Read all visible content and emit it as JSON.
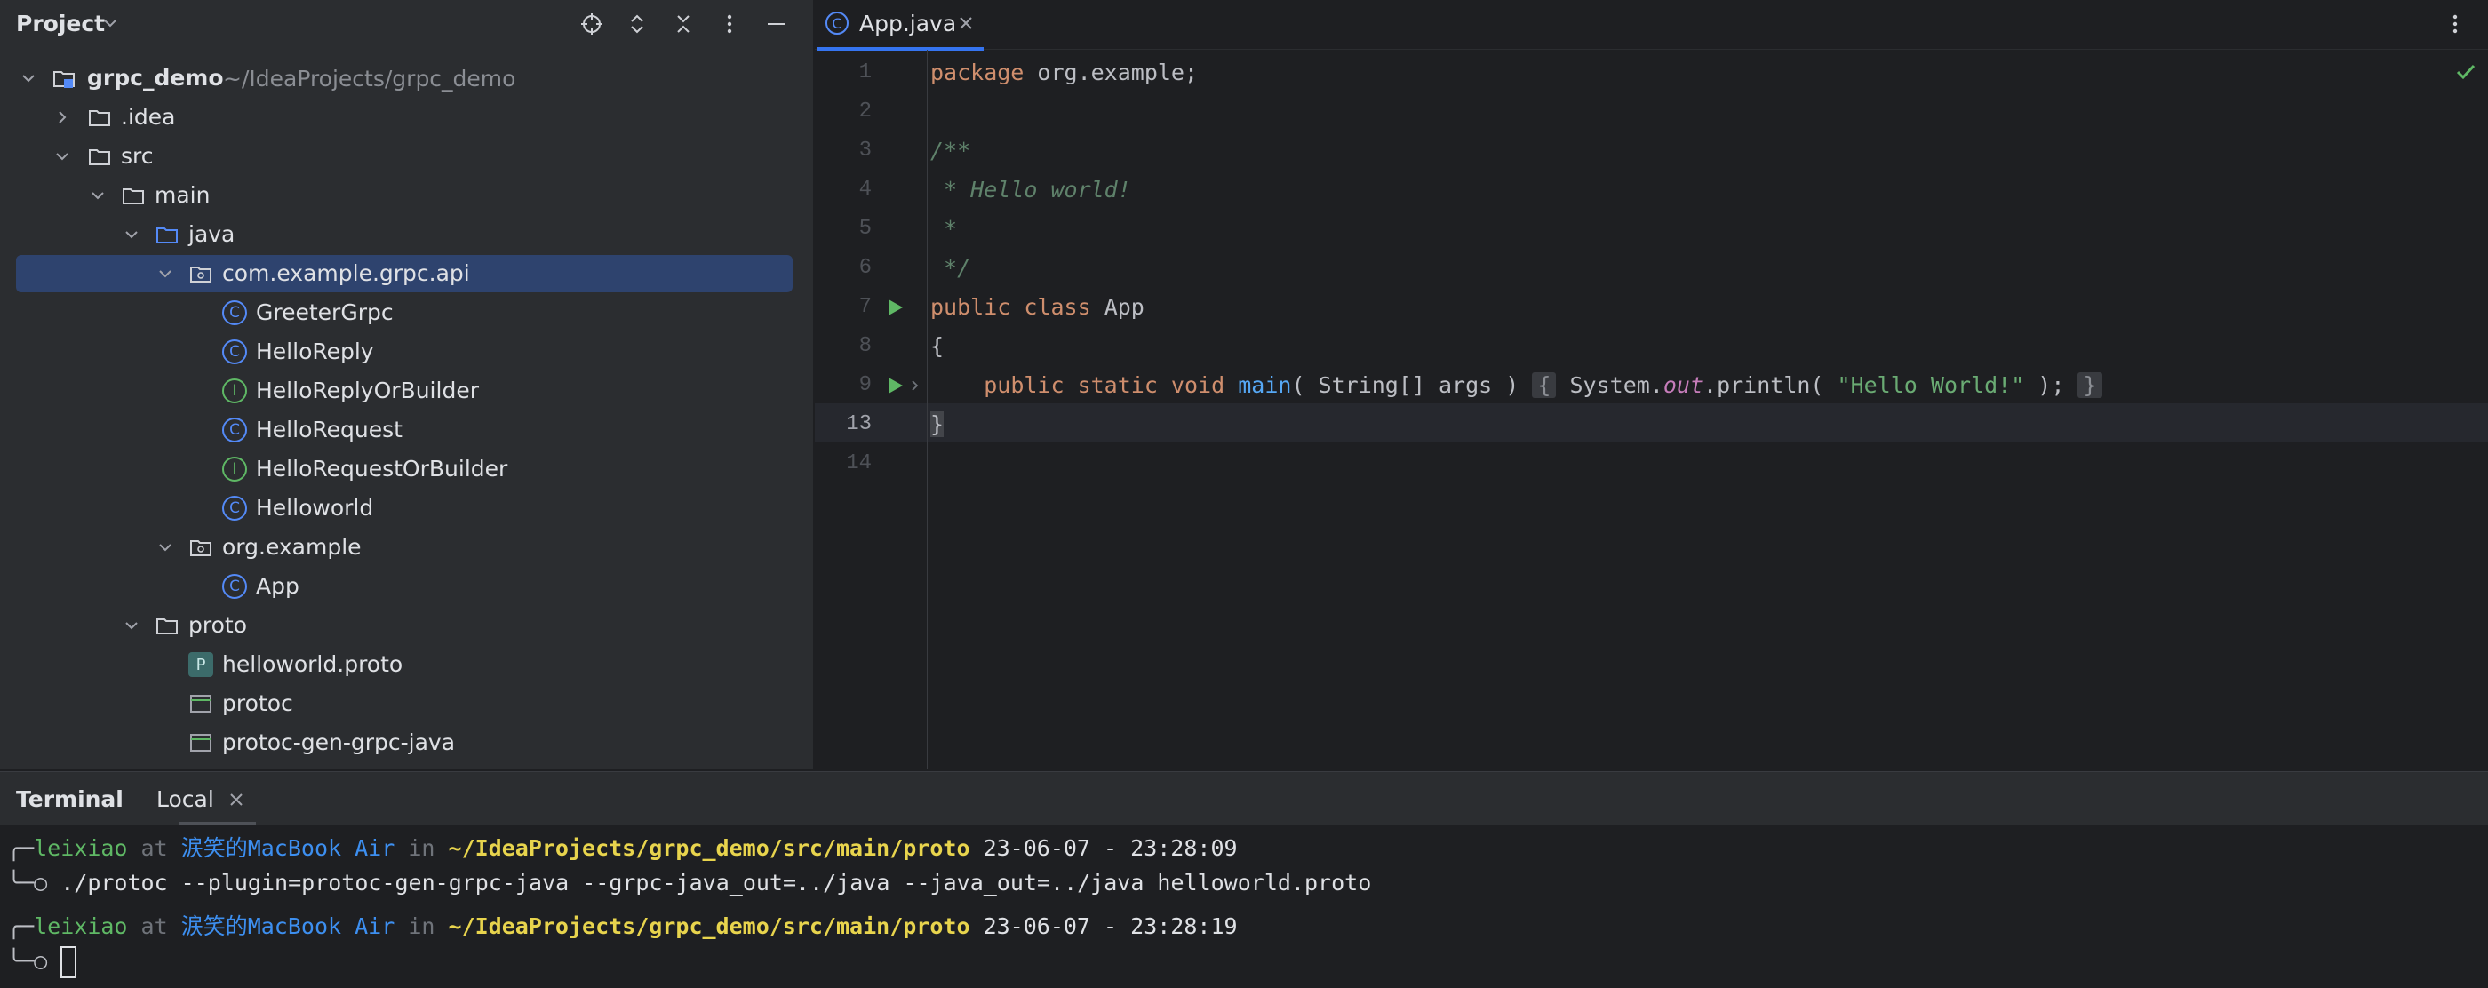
{
  "project_panel": {
    "title": "Project",
    "tree": [
      {
        "label": "grpc_demo",
        "path": "~/IdeaProjects/grpc_demo",
        "type": "module",
        "expanded": true
      },
      {
        "label": ".idea",
        "type": "folder",
        "expanded": false
      },
      {
        "label": "src",
        "type": "folder",
        "expanded": true
      },
      {
        "label": "main",
        "type": "folder",
        "expanded": true
      },
      {
        "label": "java",
        "type": "source-folder",
        "expanded": true
      },
      {
        "label": "com.example.grpc.api",
        "type": "package",
        "expanded": true,
        "selected": true
      },
      {
        "label": "GreeterGrpc",
        "type": "class"
      },
      {
        "label": "HelloReply",
        "type": "class"
      },
      {
        "label": "HelloReplyOrBuilder",
        "type": "interface"
      },
      {
        "label": "HelloRequest",
        "type": "class"
      },
      {
        "label": "HelloRequestOrBuilder",
        "type": "interface"
      },
      {
        "label": "Helloworld",
        "type": "class"
      },
      {
        "label": "org.example",
        "type": "package",
        "expanded": true
      },
      {
        "label": "App",
        "type": "class"
      },
      {
        "label": "proto",
        "type": "folder",
        "expanded": true
      },
      {
        "label": "helloworld.proto",
        "type": "proto-file"
      },
      {
        "label": "protoc",
        "type": "executable"
      },
      {
        "label": "protoc-gen-grpc-java",
        "type": "executable"
      }
    ],
    "badge_class": "C",
    "badge_interface": "I",
    "badge_proto": "P"
  },
  "editor": {
    "tab": {
      "label": "App.java",
      "badge": "C"
    },
    "lines": [
      {
        "num": "1"
      },
      {
        "num": "2"
      },
      {
        "num": "3"
      },
      {
        "num": "4"
      },
      {
        "num": "5"
      },
      {
        "num": "6"
      },
      {
        "num": "7"
      },
      {
        "num": "8"
      },
      {
        "num": "9"
      },
      {
        "num": "13"
      },
      {
        "num": "14"
      }
    ],
    "code": {
      "l1_kw": "package",
      "l1_rest": " org.example;",
      "l3": "/**",
      "l4": " * Hello world!",
      "l5": " *",
      "l6": " */",
      "l7_kw1": "public",
      "l7_kw2": "class",
      "l7_name": " App",
      "l8": "{",
      "l9_indent": "    ",
      "l9_kw": "public static void",
      "l9_fn": "main",
      "l9_args": "( String[] args ) ",
      "l9_open": "{",
      "l9_sys": " System.",
      "l9_out": "out",
      "l9_println": ".println( ",
      "l9_str": "\"Hello World!\"",
      "l9_end": " ); ",
      "l9_close": "}",
      "l13": "}"
    }
  },
  "terminal": {
    "title": "Terminal",
    "tab": "Local",
    "sessions": [
      {
        "user": "leixiao",
        "at": "at",
        "host": "涙笑的MacBook Air",
        "in": "in",
        "path": "~/IdeaProjects/grpc_demo/src/main/proto",
        "time": "23-06-07 - 23:28:09",
        "command": "./protoc --plugin=protoc-gen-grpc-java --grpc-java_out=../java --java_out=../java helloworld.proto"
      },
      {
        "user": "leixiao",
        "at": "at",
        "host": "涙笑的MacBook Air",
        "in": "in",
        "path": "~/IdeaProjects/grpc_demo/src/main/proto",
        "time": "23-06-07 - 23:28:19",
        "command": ""
      }
    ],
    "prompt_top": "╭─",
    "prompt_bottom": "╰─○ "
  },
  "colors": {
    "panel_bg": "#2b2d30",
    "editor_bg": "#1e1f22",
    "selection": "#2e436e",
    "accent": "#3574f0",
    "keyword": "#cf8e6d",
    "comment": "#5f826b",
    "string": "#6aab73"
  }
}
